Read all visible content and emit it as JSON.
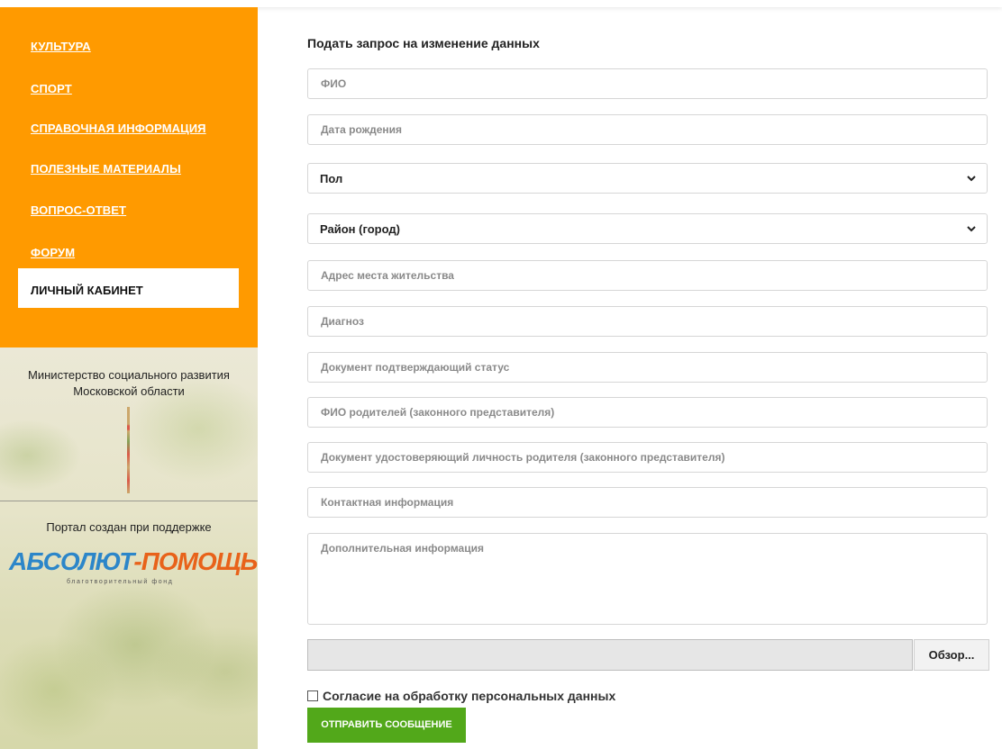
{
  "sidebar": {
    "nav": [
      {
        "label": "КУЛЬТУРА"
      },
      {
        "label": "СПОРТ"
      },
      {
        "label": "СПРАВОЧНАЯ ИНФОРМАЦИЯ"
      },
      {
        "label": "ПОЛЕЗНЫЕ МАТЕРИАЛЫ"
      },
      {
        "label": "ВОПРОС-ОТВЕТ"
      },
      {
        "label": "ФОРУМ"
      }
    ],
    "active_item": "ЛИЧНЫЙ КАБИНЕТ",
    "ministry_line1": "Министерство социального развития",
    "ministry_line2": "Московской области",
    "support_text": "Портал создан при поддержке",
    "logo_part1": "АБСОЛЮТ",
    "logo_dash": "-",
    "logo_part2": "ПОМОЩЬ",
    "logo_sub": "благотворительный фонд",
    "colors": {
      "orange": "#ff9a00",
      "logo_blue": "#2c86c9",
      "logo_orange": "#e8621a"
    }
  },
  "form": {
    "title": "Подать запрос на изменение данных",
    "fio_placeholder": "ФИО",
    "birth_placeholder": "Дата рождения",
    "gender_select": "Пол",
    "district_select": "Район (город)",
    "address_placeholder": "Адрес места жительства",
    "diagnosis_placeholder": "Диагноз",
    "status_doc_placeholder": "Документ подтверждающий статус",
    "parents_placeholder": "ФИО родителей (законного представителя)",
    "parent_doc_placeholder": "Документ удостоверяющий личность родителя (законного представителя)",
    "contact_placeholder": "Контактная информация",
    "extra_placeholder": "Дополнительная информация",
    "browse_label": "Обзор...",
    "consent_label": "Согласие на обработку персональных данных",
    "consent_checked": false,
    "submit_label": "ОТПРАВИТЬ СООБЩЕНИЕ",
    "colors": {
      "submit": "#52a81a"
    }
  }
}
